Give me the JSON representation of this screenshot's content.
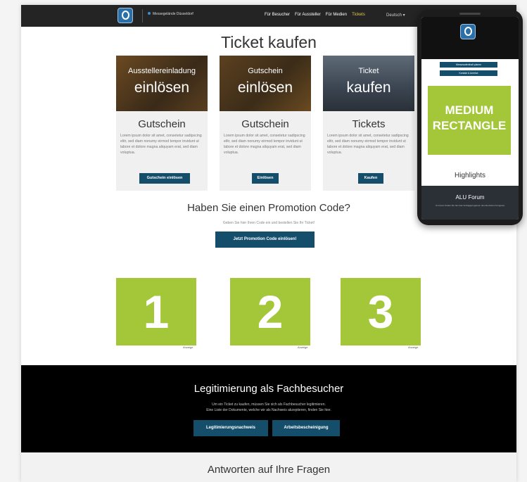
{
  "nav": {
    "tagline": "Messegelände Düsseldorf",
    "links": [
      "Für Besucher",
      "Für Aussteller",
      "Für Medien",
      "Tickets"
    ],
    "active_index": 3,
    "language": "Deutsch ▾"
  },
  "page_title": "Ticket kaufen",
  "cards": [
    {
      "image_line1": "Ausstellereinladung",
      "image_line2": "einlösen",
      "title": "Gutschein",
      "body": "Lorem ipsum dolor sit amet, consetetur sadipscing elitr, sed diam nonumy eirmod tempor invidunt ut labore et dolore magna aliquyam erat, sed diam voluptua.",
      "button": "Gutschein einlösen"
    },
    {
      "image_line1": "Gutschein",
      "image_line2": "einlösen",
      "title": "Gutschein",
      "body": "Lorem ipsum dolor sit amet, consetetur sadipscing elitr, sed diam nonumy eirmod tempor invidunt ut labore et dolore magna aliquyam erat, sed diam voluptua.",
      "button": "Einlösen"
    },
    {
      "image_line1": "Ticket",
      "image_line2": "kaufen",
      "title": "Tickets",
      "body": "Lorem ipsum dolor sit amet, consetetur sadipscing elitr, sed diam nonumy eirmod tempor invidunt ut labore et dolore magna aliquyam erat, sed diam voluptua.",
      "button": "Kaufen"
    }
  ],
  "promo": {
    "heading": "Haben Sie einen Promotion Code?",
    "subtext": "Geben Sie hier Ihren Code ein und bestellen Sie Ihr Ticket!",
    "button": "Jetzt Promotion Code einlösen!"
  },
  "ads": [
    {
      "number": "1",
      "label": "Anzeige"
    },
    {
      "number": "2",
      "label": "Anzeige"
    },
    {
      "number": "3",
      "label": "Anzeige"
    }
  ],
  "legitimation": {
    "heading": "Legitimierung als Fachbesucher",
    "line1": "Um ein Ticket zu kaufen, müssen Sie sich als Fachbesucher legitimieren.",
    "line2": "Eine Liste der Dokumente, welche wir als Nachweis akzeptieren, finden Sie hier.",
    "button1": "Legitimierungsnachweis",
    "button2": "Arbeitsbescheinigung"
  },
  "faq": {
    "heading": "Antworten auf Ihre Fragen"
  },
  "phone": {
    "button1": "Messeaufenthalt planen",
    "button2": "Kontakt & Anreise",
    "ad_line1": "MEDIUM",
    "ad_line2": "RECTANGLE",
    "highlights": "Highlights",
    "forum_title": "ALU Forum",
    "forum_text": "Im Forum finden Sie hier das Vortragsprogramm des Aluminium Kongress"
  },
  "colors": {
    "nav_bg": "#242424",
    "accent_button": "#154e6b",
    "ad_green": "#a4c639",
    "active_nav": "#e7c94c",
    "dark_section": "#000000"
  }
}
